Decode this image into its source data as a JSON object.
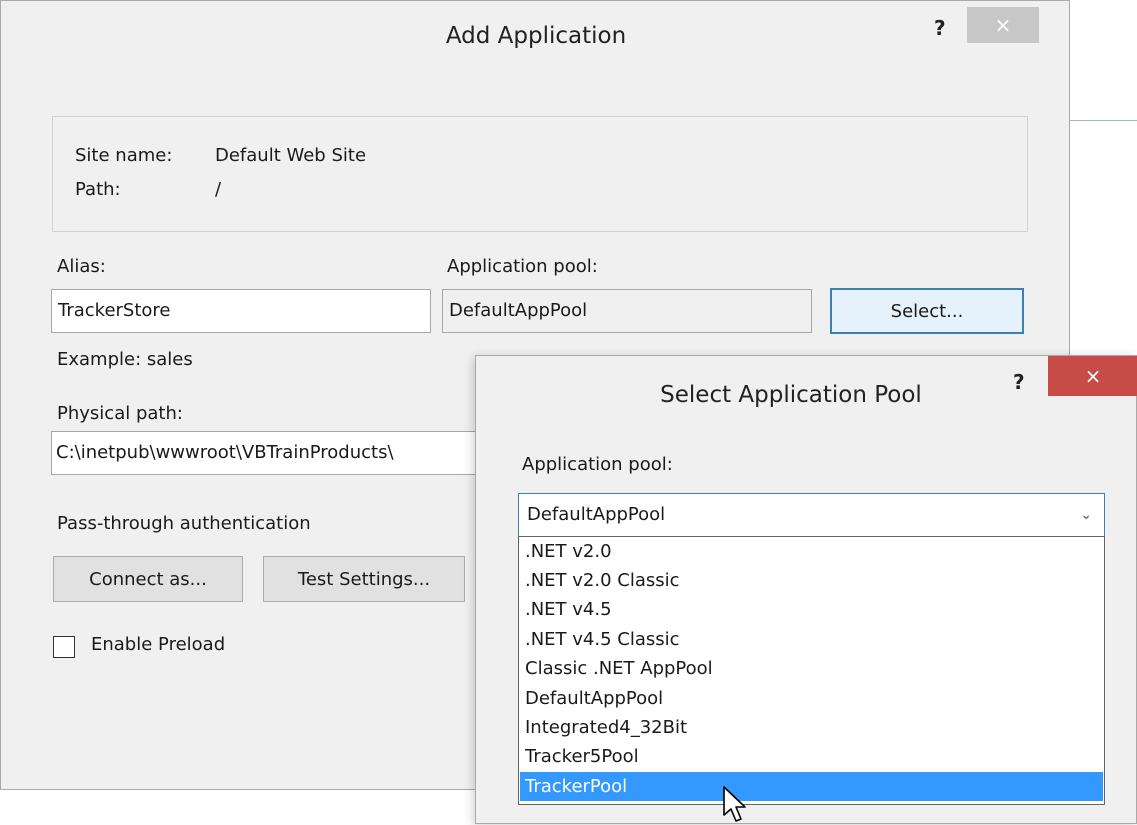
{
  "main_dialog": {
    "title": "Add Application",
    "help": "?",
    "close": "×",
    "site_name_label": "Site name:",
    "site_name_value": "Default Web Site",
    "path_label": "Path:",
    "path_value": "/",
    "alias_label": "Alias:",
    "alias_value": "TrackerStore",
    "app_pool_label": "Application pool:",
    "app_pool_value": "DefaultAppPool",
    "select_button": "Select...",
    "example_text": "Example: sales",
    "physical_path_label": "Physical path:",
    "physical_path_value": "C:\\inetpub\\wwwroot\\VBTrainProducts\\",
    "pass_through_label": "Pass-through authentication",
    "connect_as_button": "Connect as...",
    "test_settings_button": "Test Settings...",
    "enable_preload_label": "Enable Preload"
  },
  "pool_dialog": {
    "title": "Select Application Pool",
    "help": "?",
    "close": "×",
    "app_pool_label": "Application pool:",
    "selected_value": "DefaultAppPool",
    "chevron": "⌄",
    "options": [
      {
        "label": ".NET v2.0"
      },
      {
        "label": ".NET v2.0 Classic"
      },
      {
        "label": ".NET v4.5"
      },
      {
        "label": ".NET v4.5 Classic"
      },
      {
        "label": "Classic .NET AppPool"
      },
      {
        "label": "DefaultAppPool"
      },
      {
        "label": "Integrated4_32Bit"
      },
      {
        "label": "Tracker5Pool"
      },
      {
        "label": "TrackerPool"
      }
    ],
    "highlighted_option": "TrackerPool"
  },
  "colors": {
    "dialog_bg": "#f0f0f0",
    "focus_border": "#3c7fb1",
    "selection": "#3399ff",
    "close_red": "#c74b47"
  }
}
